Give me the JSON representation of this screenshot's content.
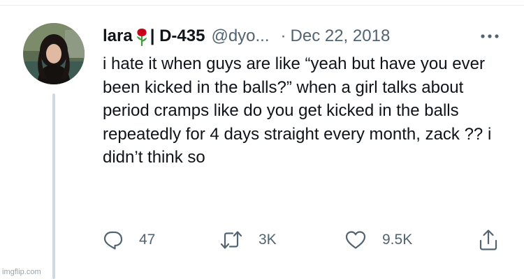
{
  "tweet": {
    "author": {
      "display_name": "lara",
      "display_emoji_icon": "rose-icon",
      "display_name_suffix": "| D-435",
      "handle": "@dyo...",
      "separator": "·"
    },
    "date": "Dec 22, 2018",
    "more_icon": "more-horizontal-icon",
    "text": "i hate it when guys are like “yeah but have you ever been kicked in the balls?” when a girl talks about period cramps like do you get kicked in the balls repeatedly for 4 days straight every month, zack ?? i didn’t think so",
    "actions": {
      "reply": {
        "icon": "reply-icon",
        "count": "47"
      },
      "retweet": {
        "icon": "retweet-icon",
        "count": "3K"
      },
      "like": {
        "icon": "heart-icon",
        "count": "9.5K"
      },
      "share": {
        "icon": "share-icon"
      }
    }
  },
  "watermark": "imgflip.com",
  "colors": {
    "primary_text": "#0f1419",
    "secondary_text": "#536471",
    "thread_line": "#cfd9de",
    "rose_red": "#d0021b",
    "rose_stem": "#3f9a3a"
  }
}
